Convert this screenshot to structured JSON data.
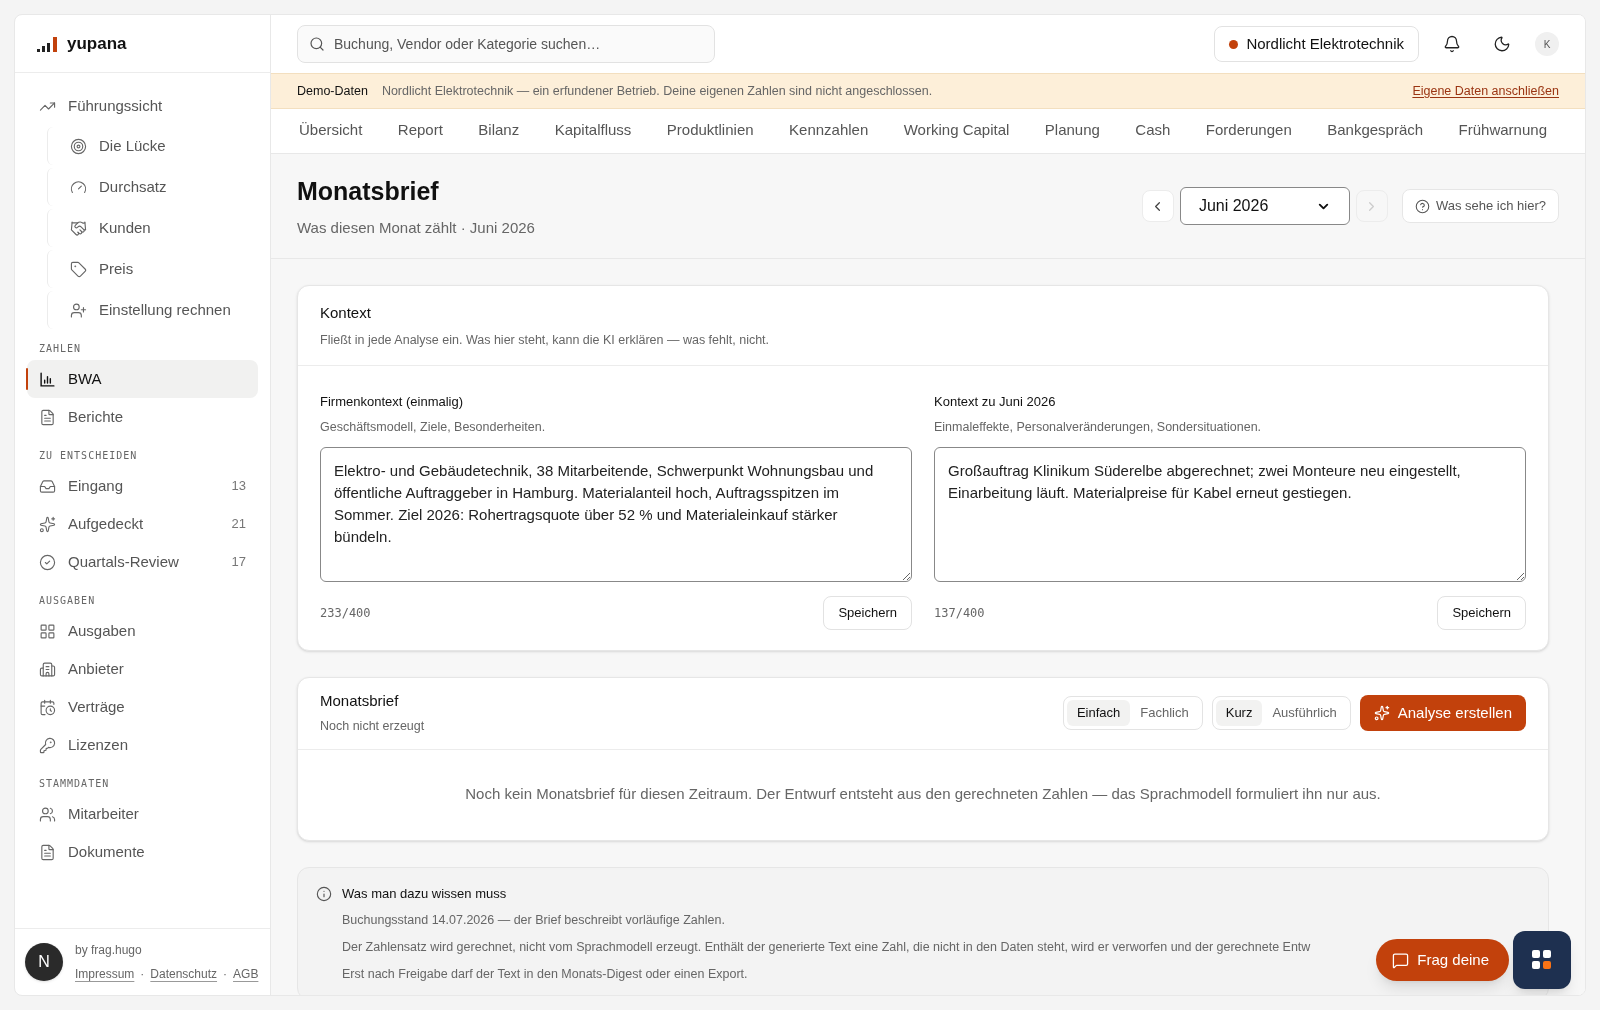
{
  "brand": {
    "name": "yupana"
  },
  "sidebar": {
    "sections": [
      {
        "items": [
          {
            "label": "Führungssicht",
            "selected": false,
            "children": [
              {
                "label": "Die Lücke",
                "selected": false
              },
              {
                "label": "Durchsatz",
                "selected": false
              },
              {
                "label": "Kunden",
                "selected": false
              },
              {
                "label": "Preis",
                "selected": false
              },
              {
                "label": "Einstellung rechnen",
                "selected": false
              }
            ]
          }
        ]
      },
      {
        "title": "ZAHLEN",
        "items": [
          {
            "label": "BWA",
            "selected": true
          },
          {
            "label": "Berichte",
            "selected": false
          }
        ]
      },
      {
        "title": "ZU ENTSCHEIDEN",
        "items": [
          {
            "label": "Eingang",
            "count": "13",
            "selected": false
          },
          {
            "label": "Aufgedeckt",
            "count": "21",
            "selected": false
          },
          {
            "label": "Quartals-Review",
            "count": "17",
            "selected": false
          }
        ]
      },
      {
        "title": "AUSGABEN",
        "items": [
          {
            "label": "Ausgaben",
            "selected": false
          },
          {
            "label": "Anbieter",
            "selected": false
          },
          {
            "label": "Verträge",
            "selected": false
          },
          {
            "label": "Lizenzen",
            "selected": false
          }
        ]
      },
      {
        "title": "STAMMDATEN",
        "items": [
          {
            "label": "Mitarbeiter",
            "selected": false
          },
          {
            "label": "Dokumente",
            "selected": false
          }
        ]
      }
    ],
    "footer": {
      "credit": "by frag.hugo",
      "links": [
        "Impressum",
        "Datenschutz",
        "AGB"
      ],
      "separator": "·"
    },
    "badge": "N"
  },
  "header": {
    "search": {
      "placeholder": "Buchung, Vendor oder Kategorie suchen…"
    },
    "company": {
      "name": "Nordlicht Elektrotechnik",
      "color": "#c2410c"
    },
    "avatar": "K"
  },
  "banner": {
    "label": "Demo-Daten",
    "text": "Nordlicht Elektrotechnik — ein erfundener Betrieb. Deine eigenen Zahlen sind nicht angeschlossen.",
    "link": "Eigene Daten anschließen"
  },
  "tabs": [
    {
      "label": "Übersicht",
      "selected": false
    },
    {
      "label": "Report",
      "selected": false
    },
    {
      "label": "Bilanz",
      "selected": false
    },
    {
      "label": "Kapitalfluss",
      "selected": false
    },
    {
      "label": "Produktlinien",
      "selected": false
    },
    {
      "label": "Kennzahlen",
      "selected": false
    },
    {
      "label": "Working Capital",
      "selected": false
    },
    {
      "label": "Planung",
      "selected": false
    },
    {
      "label": "Cash",
      "selected": false
    },
    {
      "label": "Forderungen",
      "selected": false
    },
    {
      "label": "Bankgespräch",
      "selected": false
    },
    {
      "label": "Frühwarnung",
      "selected": false
    }
  ],
  "page": {
    "title": "Monatsbrief",
    "subtitle": "Was diesen Monat zählt · Juni 2026",
    "month": "Juni 2026",
    "prev_disabled": false,
    "next_disabled": true,
    "help": "Was sehe ich hier?"
  },
  "context": {
    "title": "Kontext",
    "subtitle": "Fließt in jede Analyse ein. Was hier steht, kann die KI erklären — was fehlt, nicht.",
    "fields": [
      {
        "label": "Firmenkontext (einmalig)",
        "hint": "Geschäftsmodell, Ziele, Besonderheiten.",
        "value": "Elektro- und Gebäudetechnik, 38 Mitarbeitende, Schwerpunkt Wohnungsbau und öffentliche Auftraggeber in Hamburg. Materialanteil hoch, Auftragsspitzen im Sommer. Ziel 2026: Rohertragsquote über 52 % und Materialeinkauf stärker bündeln.",
        "counter": "233/400",
        "button": "Speichern"
      },
      {
        "label": "Kontext zu Juni 2026",
        "hint": "Einmaleffekte, Personalveränderungen, Sondersituationen.",
        "value": "Großauftrag Klinikum Süderelbe abgerechnet; zwei Monteure neu eingestellt, Einarbeitung läuft. Materialpreise für Kabel erneut gestiegen.",
        "counter": "137/400",
        "button": "Speichern"
      }
    ]
  },
  "letter": {
    "title": "Monatsbrief",
    "status": "Noch nicht erzeugt",
    "style_options": [
      {
        "label": "Einfach",
        "selected": true
      },
      {
        "label": "Fachlich",
        "selected": false
      }
    ],
    "length_options": [
      {
        "label": "Kurz",
        "selected": true
      },
      {
        "label": "Ausführlich",
        "selected": false
      }
    ],
    "action": "Analyse erstellen",
    "empty": "Noch kein Monatsbrief für diesen Zeitraum. Der Entwurf entsteht aus den gerechneten Zahlen — das Sprachmodell formuliert ihn nur aus."
  },
  "info": {
    "title": "Was man dazu wissen muss",
    "lines": [
      "Buchungsstand 14.07.2026 — der Brief beschreibt vorläufige Zahlen.",
      "Der Zahlensatz wird gerechnet, nicht vom Sprachmodell erzeugt. Enthält der generierte Text eine Zahl, die nicht in den Daten steht, wird er verworfen und der gerechnete Entw",
      "Erst nach Freigabe darf der Text in den Monats-Digest oder einen Export."
    ]
  },
  "chat": {
    "label": "Frag deine"
  }
}
